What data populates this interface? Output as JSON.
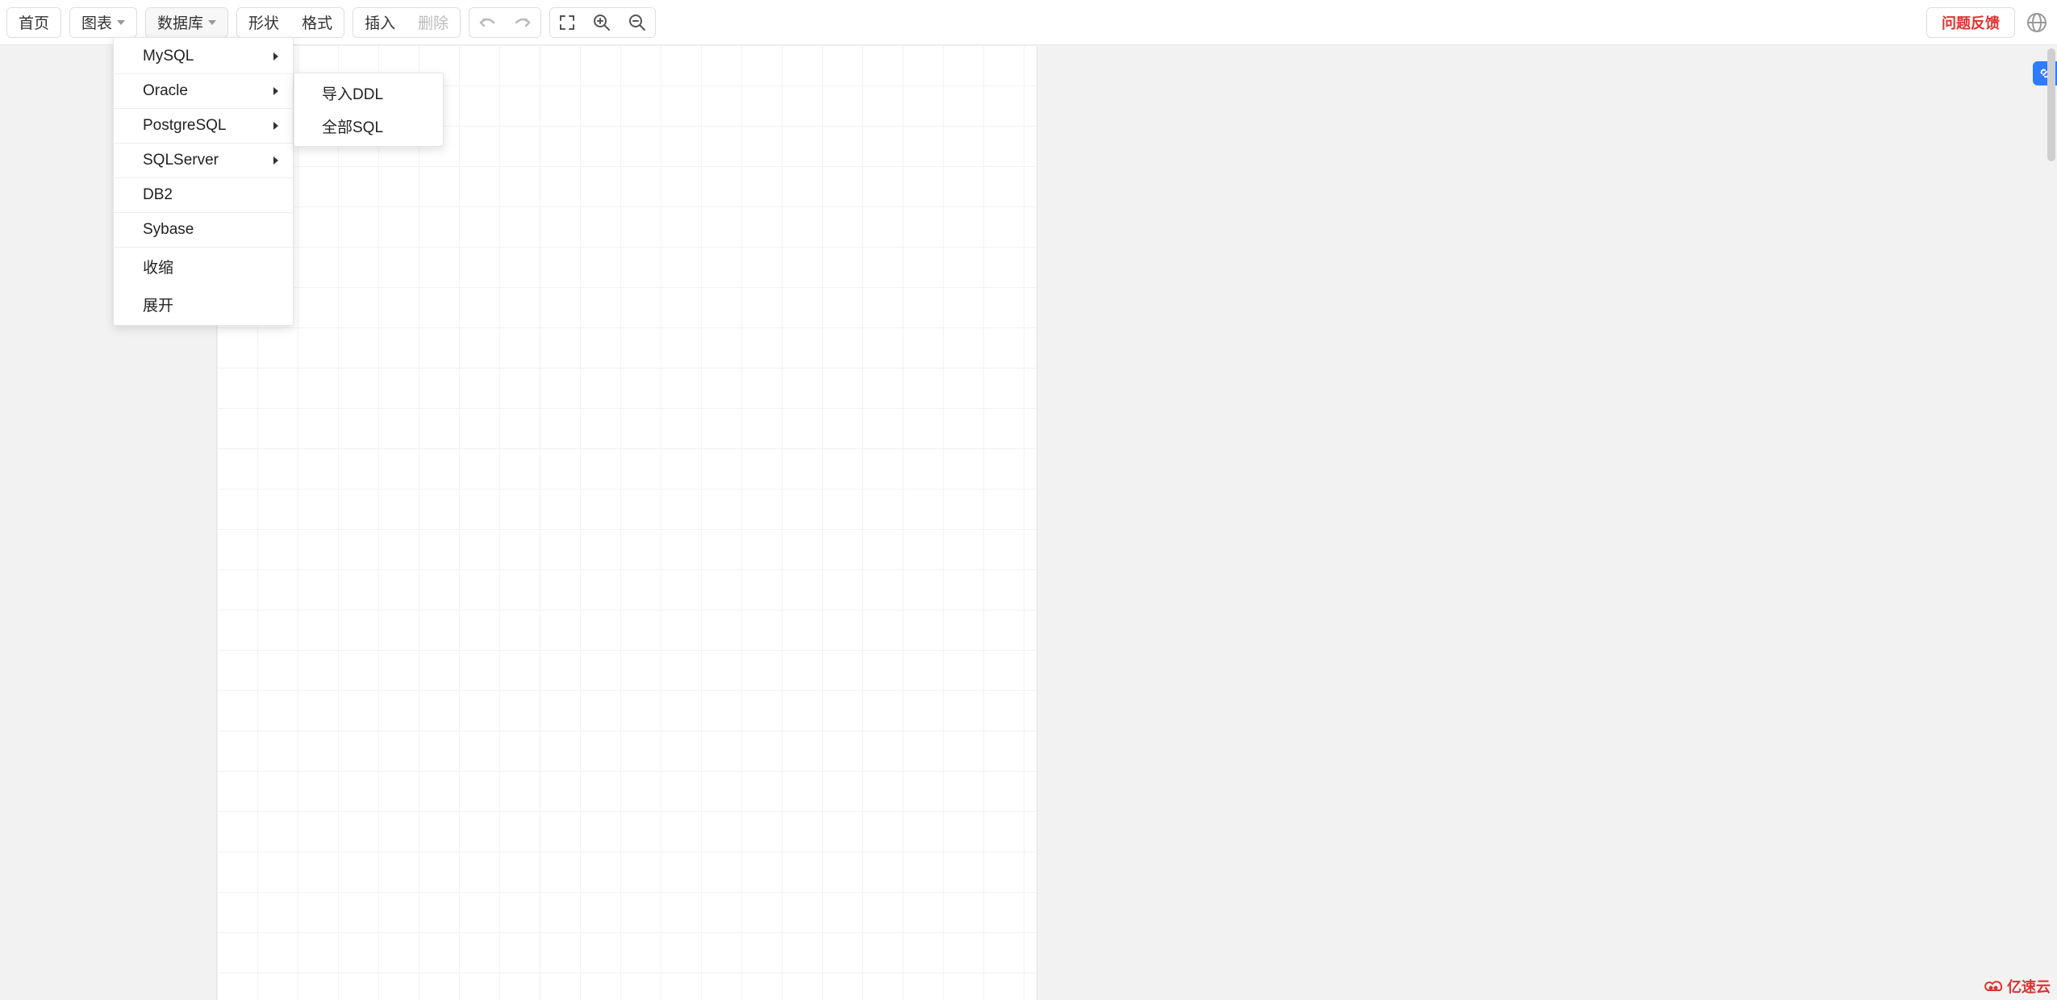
{
  "toolbar": {
    "home": "首页",
    "chart": "图表",
    "database": "数据库",
    "shape": "形状",
    "format": "格式",
    "insert": "插入",
    "delete": "删除",
    "undo_icon": "undo-icon",
    "redo_icon": "redo-icon",
    "fullscreen_icon": "fullscreen-icon",
    "zoom_in_icon": "zoom-in-icon",
    "zoom_out_icon": "zoom-out-icon",
    "feedback": "问题反馈",
    "globe_icon": "globe-icon"
  },
  "database_menu": {
    "items": [
      {
        "label": "MySQL",
        "has_submenu": true
      },
      {
        "label": "Oracle",
        "has_submenu": true
      },
      {
        "label": "PostgreSQL",
        "has_submenu": true
      },
      {
        "label": "SQLServer",
        "has_submenu": true
      },
      {
        "label": "DB2",
        "has_submenu": false
      },
      {
        "label": "Sybase",
        "has_submenu": false
      }
    ],
    "actions": [
      {
        "label": "收缩"
      },
      {
        "label": "展开"
      }
    ]
  },
  "oracle_submenu": {
    "items": [
      {
        "label": "导入DDL"
      },
      {
        "label": "全部SQL"
      }
    ]
  },
  "watermark": {
    "text": "亿速云"
  },
  "colors": {
    "accent_red": "#e03131",
    "accent_blue": "#2f7cff",
    "border": "#dddddd"
  }
}
